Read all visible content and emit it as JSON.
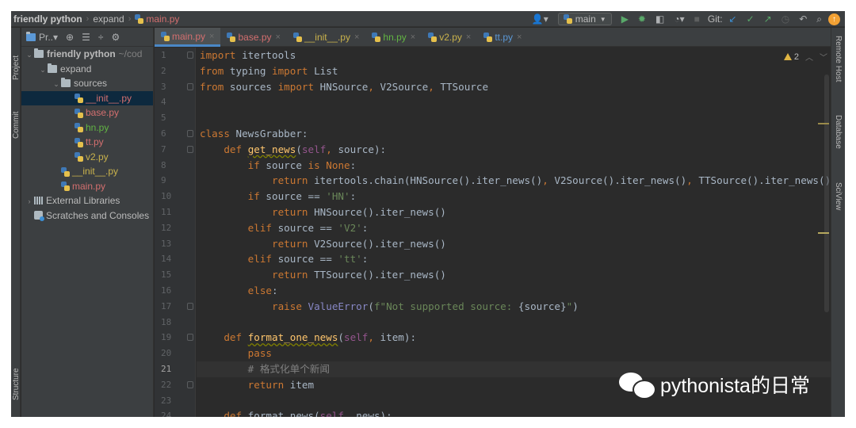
{
  "breadcrumb": {
    "root": "friendly python",
    "folder": "expand",
    "file": "main.py"
  },
  "toolbar": {
    "run_config": "main",
    "git_label": "Git:"
  },
  "left_strip": {
    "project": "Project",
    "commit": "Commit",
    "structure": "Structure"
  },
  "project_panel": {
    "title": "Pr..▾",
    "tree": [
      {
        "label": "friendly python",
        "note": "~/cod",
        "level": 0,
        "arrow": "⌄",
        "icon": "folder-icon",
        "style": "bold"
      },
      {
        "label": "expand",
        "level": 1,
        "arrow": "⌄",
        "icon": "folder-icon",
        "style": ""
      },
      {
        "label": "sources",
        "level": 2,
        "arrow": "⌄",
        "icon": "folder-icon",
        "style": ""
      },
      {
        "label": "__init__.py",
        "level": 3,
        "icon": "python-file-icon",
        "style": "red",
        "selected": true
      },
      {
        "label": "base.py",
        "level": 3,
        "icon": "python-file-icon",
        "style": "red"
      },
      {
        "label": "hn.py",
        "level": 3,
        "icon": "python-file-icon",
        "style": "green"
      },
      {
        "label": "tt.py",
        "level": 3,
        "icon": "python-file-icon",
        "style": "red"
      },
      {
        "label": "v2.py",
        "level": 3,
        "icon": "python-file-icon",
        "style": "yellow"
      },
      {
        "label": "__init__.py",
        "level": 2,
        "icon": "python-file-icon",
        "style": "yellow"
      },
      {
        "label": "main.py",
        "level": 2,
        "icon": "python-file-icon",
        "style": "red"
      },
      {
        "label": "External Libraries",
        "level": 0,
        "arrow": "›",
        "icon": "library-icon",
        "style": ""
      },
      {
        "label": "Scratches and Consoles",
        "level": 0,
        "icon": "scratch-icon",
        "style": ""
      }
    ]
  },
  "tabs": [
    {
      "label": "main.py",
      "style": "red",
      "active": true
    },
    {
      "label": "base.py",
      "style": "red"
    },
    {
      "label": "__init__.py",
      "style": "yellow"
    },
    {
      "label": "hn.py",
      "style": "green"
    },
    {
      "label": "v2.py",
      "style": "yellow"
    },
    {
      "label": "tt.py",
      "style": "blue"
    }
  ],
  "editor": {
    "warning_count": "2",
    "current_line": 21,
    "lines": [
      [
        [
          "kw",
          "import"
        ],
        [
          "plain",
          " itertools"
        ]
      ],
      [
        [
          "kw",
          "from"
        ],
        [
          "plain",
          " typing "
        ],
        [
          "kw",
          "import"
        ],
        [
          "plain",
          " List"
        ]
      ],
      [
        [
          "kw",
          "from"
        ],
        [
          "plain",
          " sources "
        ],
        [
          "kw",
          "import"
        ],
        [
          "plain",
          " HNSource"
        ],
        [
          "kw",
          ","
        ],
        [
          "plain",
          " V2Source"
        ],
        [
          "kw",
          ","
        ],
        [
          "plain",
          " TTSource"
        ]
      ],
      [],
      [],
      [
        [
          "kw",
          "class"
        ],
        [
          "plain",
          " NewsGrabber:"
        ]
      ],
      [
        [
          "plain",
          "    "
        ],
        [
          "kw",
          "def"
        ],
        [
          "plain",
          " "
        ],
        [
          "fn",
          "get_news"
        ],
        [
          "plain",
          "("
        ],
        [
          "self",
          "self"
        ],
        [
          "kw",
          ","
        ],
        [
          "plain",
          " source):"
        ]
      ],
      [
        [
          "plain",
          "        "
        ],
        [
          "kw",
          "if"
        ],
        [
          "plain",
          " source "
        ],
        [
          "kw",
          "is"
        ],
        [
          "plain",
          " "
        ],
        [
          "kw",
          "None"
        ],
        [
          "plain",
          ":"
        ]
      ],
      [
        [
          "plain",
          "            "
        ],
        [
          "kw",
          "return"
        ],
        [
          "plain",
          " itertools.chain(HNSource().iter_news()"
        ],
        [
          "kw",
          ","
        ],
        [
          "plain",
          " V2Source().iter_news()"
        ],
        [
          "kw",
          ","
        ],
        [
          "plain",
          " TTSource().iter_news())"
        ]
      ],
      [
        [
          "plain",
          "        "
        ],
        [
          "kw",
          "if"
        ],
        [
          "plain",
          " source == "
        ],
        [
          "str",
          "'HN'"
        ],
        [
          "plain",
          ":"
        ]
      ],
      [
        [
          "plain",
          "            "
        ],
        [
          "kw",
          "return"
        ],
        [
          "plain",
          " HNSource().iter_news()"
        ]
      ],
      [
        [
          "plain",
          "        "
        ],
        [
          "kw",
          "elif"
        ],
        [
          "plain",
          " source == "
        ],
        [
          "str",
          "'V2'"
        ],
        [
          "plain",
          ":"
        ]
      ],
      [
        [
          "plain",
          "            "
        ],
        [
          "kw",
          "return"
        ],
        [
          "plain",
          " V2Source().iter_news()"
        ]
      ],
      [
        [
          "plain",
          "        "
        ],
        [
          "kw",
          "elif"
        ],
        [
          "plain",
          " source == "
        ],
        [
          "str",
          "'tt'"
        ],
        [
          "plain",
          ":"
        ]
      ],
      [
        [
          "plain",
          "            "
        ],
        [
          "kw",
          "return"
        ],
        [
          "plain",
          " TTSource().iter_news()"
        ]
      ],
      [
        [
          "plain",
          "        "
        ],
        [
          "kw",
          "else"
        ],
        [
          "plain",
          ":"
        ]
      ],
      [
        [
          "plain",
          "            "
        ],
        [
          "kw",
          "raise"
        ],
        [
          "plain",
          " "
        ],
        [
          "cls",
          "ValueError"
        ],
        [
          "plain",
          "("
        ],
        [
          "str",
          "f\"Not supported source: "
        ],
        [
          "plain",
          "{source}"
        ],
        [
          "str",
          "\""
        ],
        [
          "plain",
          ")"
        ]
      ],
      [],
      [
        [
          "plain",
          "    "
        ],
        [
          "kw",
          "def"
        ],
        [
          "plain",
          " "
        ],
        [
          "fn",
          "format_one_news"
        ],
        [
          "plain",
          "("
        ],
        [
          "self",
          "self"
        ],
        [
          "kw",
          ","
        ],
        [
          "plain",
          " item):"
        ]
      ],
      [
        [
          "plain",
          "        "
        ],
        [
          "kw",
          "pass"
        ]
      ],
      [
        [
          "plain",
          "        "
        ],
        [
          "com",
          "# 格式化单个新闻"
        ]
      ],
      [
        [
          "plain",
          "        "
        ],
        [
          "kw",
          "return"
        ],
        [
          "plain",
          " item"
        ]
      ],
      [],
      [
        [
          "plain",
          "    "
        ],
        [
          "kw",
          "def"
        ],
        [
          "plain",
          " format_news("
        ],
        [
          "self",
          "self"
        ],
        [
          "kw",
          ","
        ],
        [
          "plain",
          " news):"
        ]
      ]
    ]
  },
  "right_strip": {
    "remote_host": "Remote Host",
    "database": "Database",
    "sciview": "SciView"
  },
  "watermark": {
    "text": "pythonista的日常"
  },
  "colors": {
    "keyword": "#cc7832",
    "string": "#6a8759",
    "function": "#ffc66d",
    "self": "#94558d",
    "builtin": "#8888c6",
    "comment": "#808080",
    "text": "#a9b7c6",
    "editor_bg": "#2b2b2b",
    "panel_bg": "#3c3f41",
    "selection": "#0d293e"
  }
}
